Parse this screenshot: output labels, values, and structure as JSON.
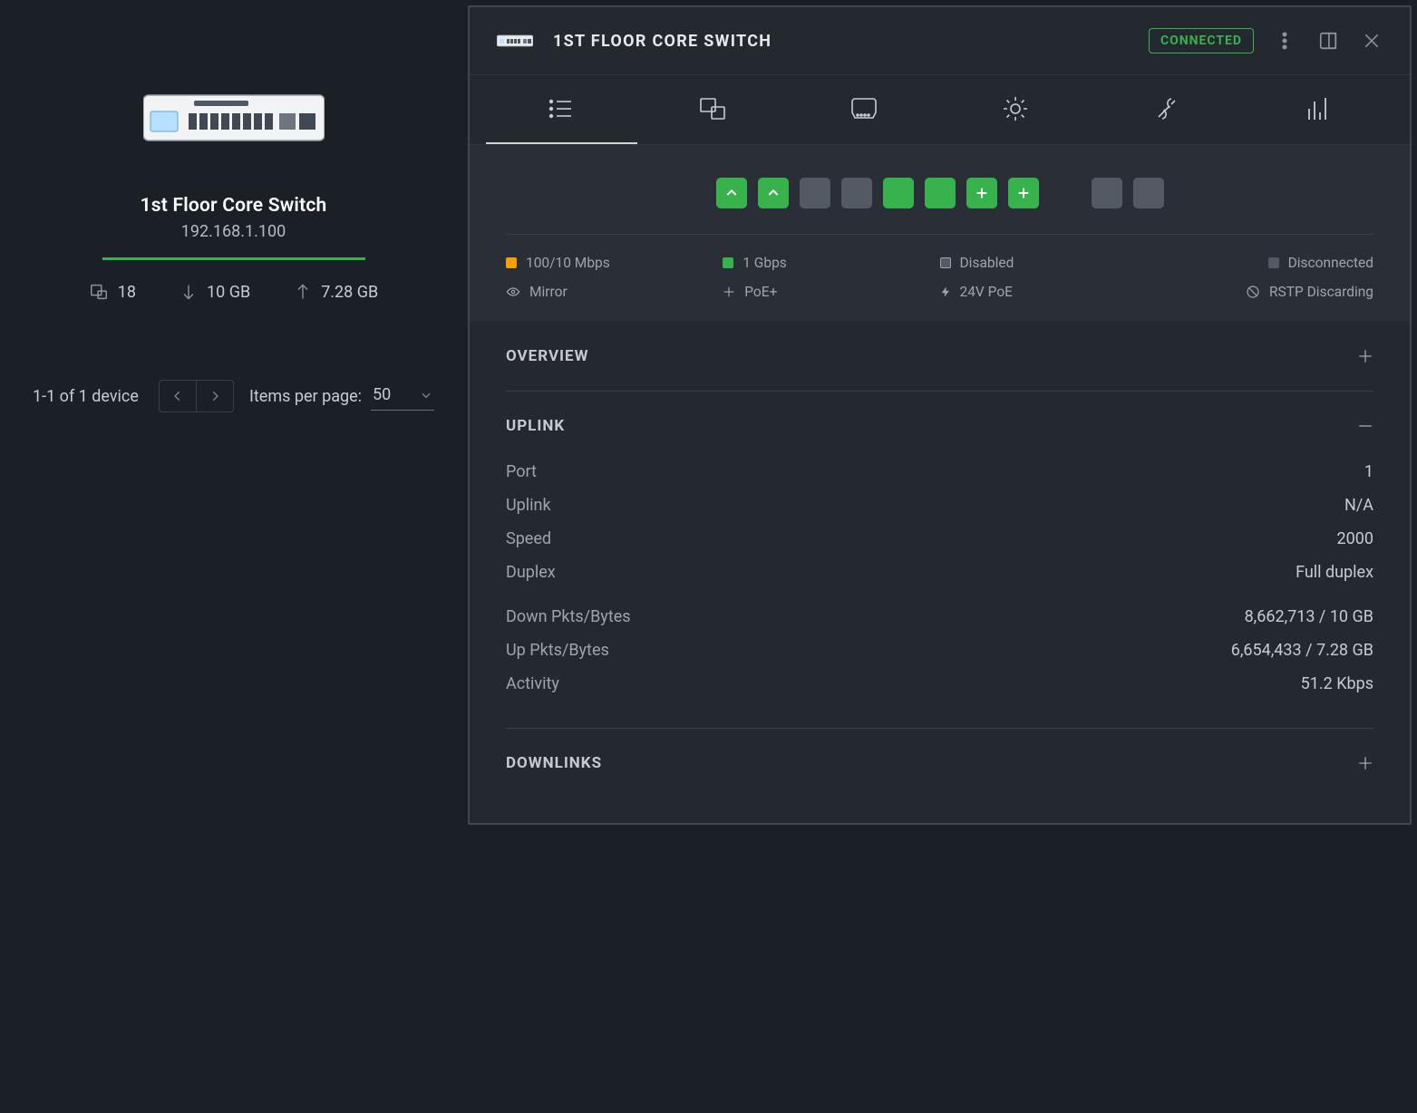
{
  "device": {
    "name": "1st Floor Core Switch",
    "ip": "192.168.1.100",
    "clients": "18",
    "down": "10 GB",
    "up": "7.28 GB"
  },
  "pagination": {
    "range": "1-1 of 1 device",
    "ipp_label": "Items per page:",
    "ipp_value": "50"
  },
  "panel": {
    "title": "1ST FLOOR CORE SWITCH",
    "status": "CONNECTED"
  },
  "ports": [
    {
      "type": "green",
      "icon": "chevron-up"
    },
    {
      "type": "green",
      "icon": "chevron-up"
    },
    {
      "type": "idle",
      "icon": ""
    },
    {
      "type": "idle",
      "icon": ""
    },
    {
      "type": "green",
      "icon": ""
    },
    {
      "type": "green",
      "icon": ""
    },
    {
      "type": "green",
      "icon": "plus"
    },
    {
      "type": "green",
      "icon": "plus"
    },
    {
      "type": "gap",
      "icon": ""
    },
    {
      "type": "idle",
      "icon": ""
    },
    {
      "type": "idle",
      "icon": ""
    }
  ],
  "legend": {
    "r1c1": "100/10 Mbps",
    "r1c2": "1 Gbps",
    "r1c3": "Disabled",
    "r1c4": "Disconnected",
    "r2c1": "Mirror",
    "r2c2": "PoE+",
    "r2c3": "24V PoE",
    "r2c4": "RSTP Discarding"
  },
  "sections": {
    "overview": "OVERVIEW",
    "uplink": "UPLINK",
    "downlinks": "DOWNLINKS"
  },
  "uplink": {
    "rows": [
      {
        "k": "Port",
        "v": "1"
      },
      {
        "k": "Uplink",
        "v": "N/A"
      },
      {
        "k": "Speed",
        "v": "2000"
      },
      {
        "k": "Duplex",
        "v": "Full duplex"
      }
    ],
    "rows2": [
      {
        "k": "Down Pkts/Bytes",
        "v": "8,662,713 / 10 GB"
      },
      {
        "k": "Up Pkts/Bytes",
        "v": "6,654,433 / 7.28 GB"
      },
      {
        "k": "Activity",
        "v": "51.2 Kbps"
      }
    ]
  }
}
